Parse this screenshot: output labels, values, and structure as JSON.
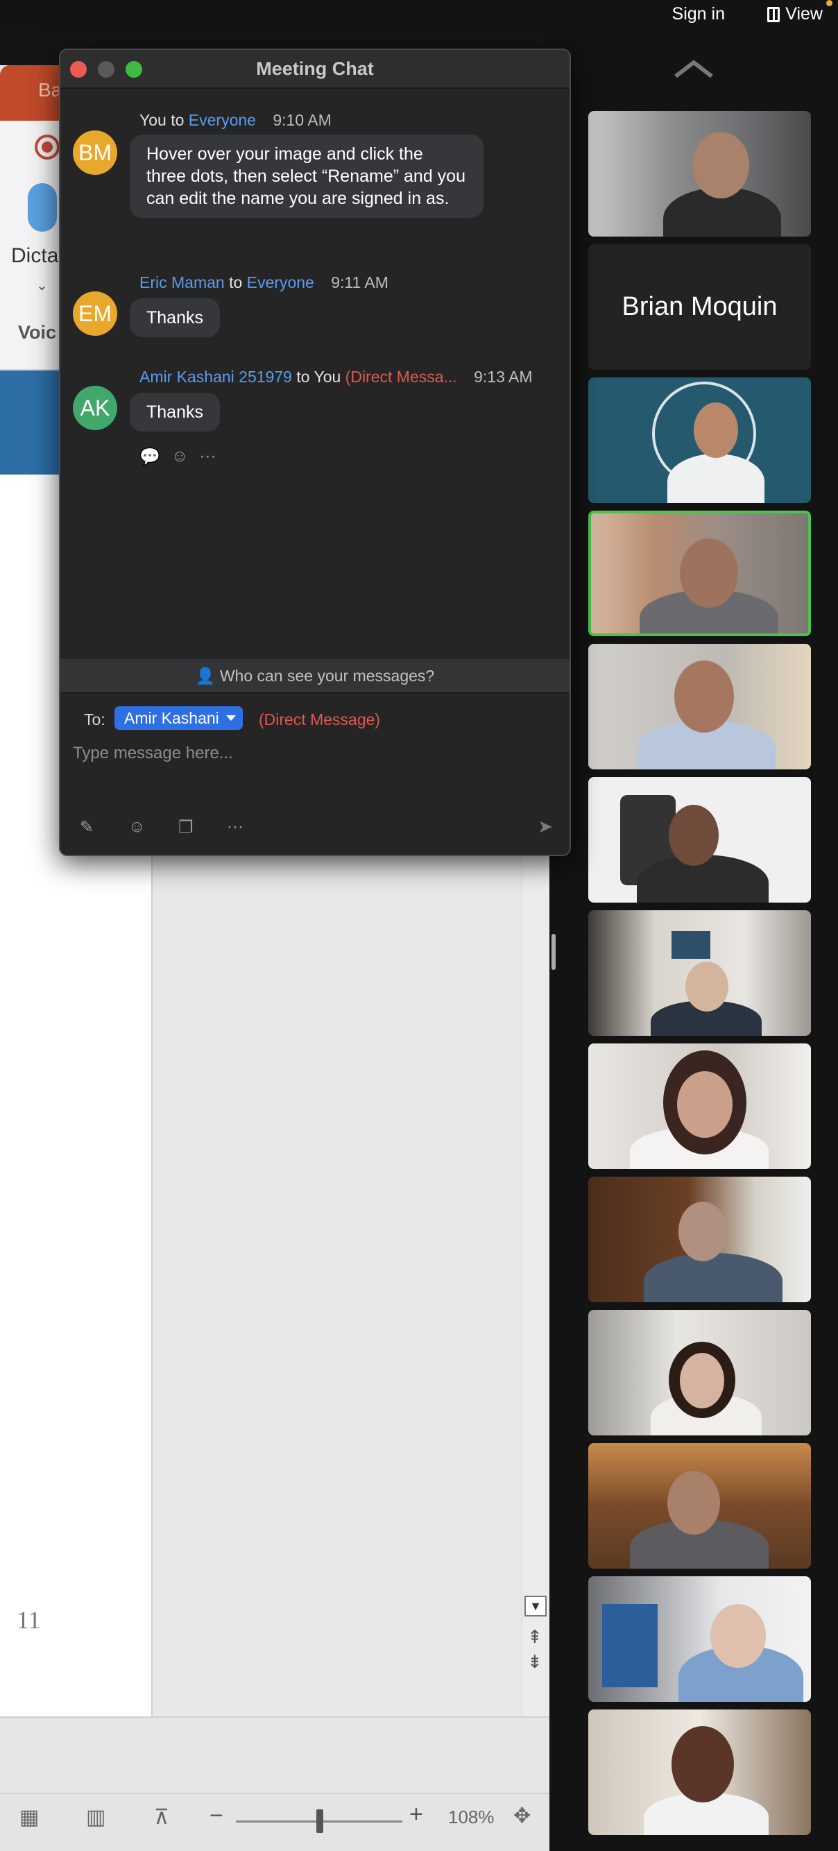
{
  "topbar": {
    "sign_in": "Sign in",
    "view": "View"
  },
  "powerpoint": {
    "tab_fragment": "Ba",
    "dictate_label": "Dicta",
    "voice_label": "Voic",
    "slide_number": "11",
    "zoom_level": "108%",
    "brand_color": "#c04a2a"
  },
  "chat": {
    "title": "Meeting Chat",
    "messages": [
      {
        "avatar_initials": "BM",
        "avatar_color": "#e9a82b",
        "sender": "You",
        "connector": "to",
        "recipient": "Everyone",
        "time": "9:10 AM",
        "text": "Hover over your image and click the three dots, then select “Rename” and you can edit the name you are signed in as."
      },
      {
        "avatar_initials": "EM",
        "avatar_color": "#e9a82b",
        "sender": "Eric Maman",
        "connector": "to",
        "recipient": "Everyone",
        "time": "9:11 AM",
        "text": "Thanks"
      },
      {
        "avatar_initials": "AK",
        "avatar_color": "#3fa86a",
        "sender": "Amir Kashani 251979",
        "connector": "to You",
        "recipient": "(Direct Messa...",
        "time": "9:13 AM",
        "text": "Thanks"
      }
    ],
    "visibility_text": "Who can see your messages?",
    "compose": {
      "to_label": "To:",
      "recipient": "Amir Kashani",
      "dm_label": "(Direct Message)",
      "placeholder": "Type message here..."
    }
  },
  "gallery": {
    "name_tile": "Brian Moquin",
    "speaking_color": "#4cc34c"
  }
}
